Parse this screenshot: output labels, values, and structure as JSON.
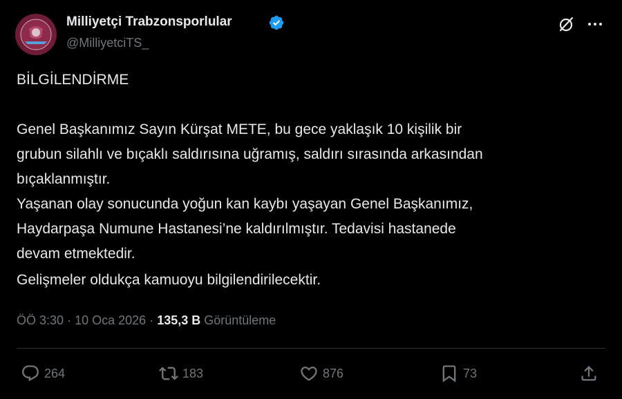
{
  "author": {
    "display_name": "Milliyetçi Trabzonsporlular",
    "handle": "@MilliyetciTS_",
    "verified": true
  },
  "tweet": {
    "lines": [
      "BİLGİLENDİRME",
      "Genel Başkanımız Sayın Kürşat METE, bu gece yaklaşık 10 kişilik bir",
      "grubun silahlı ve bıçaklı saldırısına uğramış, saldırı sırasında arkasından",
      "bıçaklanmıştır.",
      "Yaşanan olay sonucunda yoğun kan kaybı yaşayan Genel Başkanımız,",
      "Haydarpaşa Numune Hastanesi’ne kaldırılmıştır. Tedavisi hastanede",
      "devam etmektedir.",
      "Gelişmeler oldukça kamuoyu bilgilendirilecektir."
    ]
  },
  "meta": {
    "time": "ÖÖ 3:30",
    "separator": "·",
    "date": "10 Oca 2026",
    "views_count": "135,3 B",
    "views_label": "Görüntüleme"
  },
  "actions": {
    "replies": "264",
    "reposts": "183",
    "likes": "876",
    "bookmarks": "73"
  },
  "icons": {
    "verified": "verified-badge-icon",
    "grok": "grok-icon",
    "more": "more-icon",
    "reply": "reply-icon",
    "repost": "repost-icon",
    "like": "heart-icon",
    "bookmark": "bookmark-icon",
    "share": "share-icon"
  },
  "colors": {
    "background": "#000000",
    "text": "#e7e9ea",
    "secondary_text": "#71767b",
    "verified_blue": "#1d9bf0",
    "divider": "#2f3336"
  }
}
